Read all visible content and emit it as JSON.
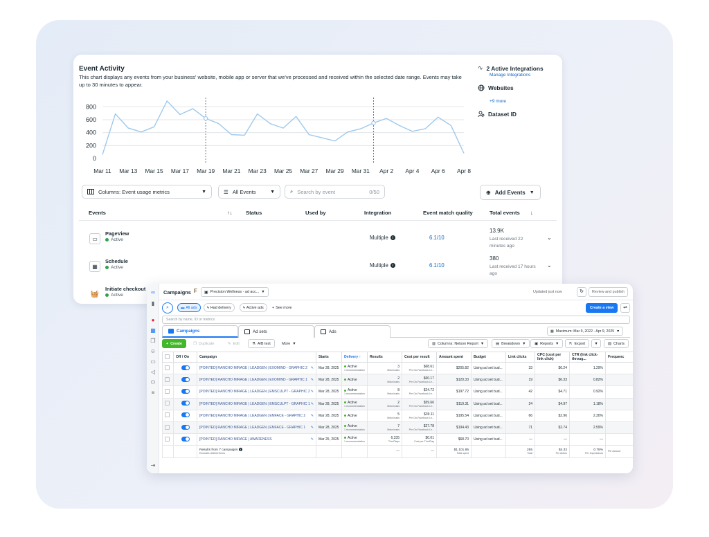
{
  "colors": {
    "accent": "#1877f2",
    "link": "#0a66c2",
    "active_green": "#31a24c",
    "chart_line": "#9ec9ec"
  },
  "event_activity": {
    "title": "Event Activity",
    "description": "This chart displays any events from your business' website, mobile app or server that we've processed and received within the selected date range. Events may take up to 30 minutes to appear."
  },
  "chart_data": {
    "type": "line",
    "title": "",
    "xlabel": "",
    "ylabel": "",
    "ylim": [
      0,
      900
    ],
    "yticks": [
      "800",
      "600",
      "400",
      "200",
      "0"
    ],
    "x_tick_labels": [
      "Mar 11",
      "Mar 13",
      "Mar 15",
      "Mar 17",
      "Mar 19",
      "Mar 21",
      "Mar 23",
      "Mar 25",
      "Mar 27",
      "Mar 29",
      "Mar 31",
      "Apr 2",
      "Apr 4",
      "Apr 6",
      "Apr 8"
    ],
    "x": [
      "Mar 11",
      "Mar 12",
      "Mar 13",
      "Mar 14",
      "Mar 15",
      "Mar 16",
      "Mar 17",
      "Mar 18",
      "Mar 19",
      "Mar 20",
      "Mar 21",
      "Mar 22",
      "Mar 23",
      "Mar 24",
      "Mar 25",
      "Mar 26",
      "Mar 27",
      "Mar 28",
      "Mar 29",
      "Mar 30",
      "Mar 31",
      "Apr 1",
      "Apr 2",
      "Apr 3",
      "Apr 4",
      "Apr 5",
      "Apr 6",
      "Apr 7",
      "Apr 8"
    ],
    "series": [
      {
        "values": [
          60,
          690,
          470,
          410,
          490,
          890,
          680,
          770,
          620,
          540,
          370,
          360,
          690,
          540,
          470,
          650,
          370,
          320,
          270,
          410,
          460,
          550,
          620,
          510,
          420,
          460,
          640,
          510,
          80
        ]
      }
    ],
    "markers_at": [
      "Mar 19",
      "Apr 1"
    ],
    "grid": true
  },
  "right_panel": {
    "integrations": "2 Active Integrations",
    "manage": "Manage Integrations",
    "websites": "Websites",
    "more": "+9 more",
    "dataset": "Dataset ID"
  },
  "toolbar": {
    "columns": "Columns: Event usage metrics",
    "all_events": "All Events",
    "search_placeholder": "Search by event",
    "search_count": "0/50",
    "add_events": "Add Events"
  },
  "events_table": {
    "headers": {
      "events": "Events",
      "sort": "↑↓",
      "status": "Status",
      "used_by": "Used by",
      "integration": "Integration",
      "emq": "Event match quality",
      "total": "Total events",
      "total_sort": "↓"
    },
    "rows": [
      {
        "name": "PageView",
        "status": "Active",
        "integration": "Multiple",
        "emq": "6.1/10",
        "total": "13.9K",
        "received": "Last received 22 minutes ago",
        "icon": "page-icon"
      },
      {
        "name": "Schedule",
        "status": "Active",
        "integration": "Multiple",
        "emq": "6.1/10",
        "total": "380",
        "received": "Last received 17 hours ago",
        "icon": "calendar-icon"
      },
      {
        "name": "Initiate checkout",
        "status": "Active",
        "icon": "basket-icon"
      }
    ]
  },
  "ads_manager": {
    "title": "Campaigns",
    "account": "Precision Wellness - ad acc...",
    "updated": "Updated just now",
    "review": "Review and publish",
    "more": "···",
    "filters": [
      "All ads",
      "Had delivery",
      "Active ads",
      "See more"
    ],
    "create_view": "Create a view",
    "search_placeholder": "Search by name, ID or metrics",
    "tabs": [
      "Campaigns",
      "Ad sets",
      "Ads"
    ],
    "date_range": "Maximum: Mar 9, 2022 - Apr 9, 2025",
    "actions": {
      "create": "Create",
      "duplicate": "Duplicate",
      "edit": "Edit",
      "ab_test": "A/B test",
      "more": "More",
      "columns": "Columns: Nelson Report",
      "breakdown": "Breakdown",
      "reports": "Reports",
      "export": "Export",
      "charts": "Charts"
    },
    "columns": [
      "Off / On",
      "Campaign",
      "Starts",
      "Delivery ↑",
      "Results",
      "Cost per result",
      "Amount spent",
      "Budget",
      "Link clicks",
      "CPC (cost per link click)",
      "CTR (link click-throug...",
      "Frequenc"
    ],
    "rows": [
      {
        "name": "[POINTED] RANCHO MIRAGE | LEADGEN | EXOMIND - GRAPHIC 2",
        "starts": "Mar 28, 2025",
        "delivery": "Active",
        "delivery_sub": "1 recommendation",
        "results": "3",
        "results_sub": "Meta leads",
        "cost": "$68.61",
        "cost_sub": "Per On-Facebook Le...",
        "spent": "$205.82",
        "budget": "Using ad set bud...",
        "clicks": "33",
        "cpc": "$6.24",
        "ctr": "1.29%"
      },
      {
        "name": "[POINTED] RANCHO MIRAGE | LEADGEN | EXOMIND - GRAPHIC 1",
        "starts": "Mar 28, 2025",
        "delivery": "Active",
        "delivery_sub": "",
        "results": "2",
        "results_sub": "Meta leads",
        "cost": "$60.17",
        "cost_sub": "Per On-Facebook Le...",
        "spent": "$120.33",
        "budget": "Using ad set bud...",
        "clicks": "19",
        "cpc": "$6.33",
        "ctr": "0.82%"
      },
      {
        "name": "[POINTED] RANCHO MIRAGE | LEADGEN | EMSCULPT - GRAPHIC 2",
        "starts": "Mar 28, 2025",
        "delivery": "Active",
        "delivery_sub": "1 recommendation",
        "results": "8",
        "results_sub": "Meta leads",
        "cost": "$24.72",
        "cost_sub": "Per On-Facebook Le...",
        "spent": "$197.72",
        "budget": "Using ad set bud...",
        "clicks": "42",
        "cpc": "$4.71",
        "ctr": "0.92%"
      },
      {
        "name": "[POINTED] RANCHO MIRAGE | LEADGEN | EMSCULPT - GRAPHIC 1",
        "starts": "Mar 28, 2025",
        "delivery": "Active",
        "delivery_sub": "1 recommendation",
        "results": "2",
        "results_sub": "Meta leads",
        "cost": "$59.66",
        "cost_sub": "Per On-Facebook Le...",
        "spent": "$119.31",
        "budget": "Using ad set bud...",
        "clicks": "24",
        "cpc": "$4.97",
        "ctr": "1.18%"
      },
      {
        "name": "[POINTED] RANCHO MIRAGE | LEADGEN | EMFACE - GRAPHIC 2",
        "starts": "Mar 28, 2025",
        "delivery": "Active",
        "delivery_sub": "",
        "results": "5",
        "results_sub": "Meta leads",
        "cost": "$39.11",
        "cost_sub": "Per On-Facebook Le...",
        "spent": "$195.54",
        "budget": "Using ad set bud...",
        "clicks": "66",
        "cpc": "$2.96",
        "ctr": "2.30%"
      },
      {
        "name": "[POINTED] RANCHO MIRAGE | LEADGEN | EMFACE - GRAPHIC 1",
        "starts": "Mar 28, 2025",
        "delivery": "Active",
        "delivery_sub": "1 recommendation",
        "results": "7",
        "results_sub": "Meta leads",
        "cost": "$27.78",
        "cost_sub": "Per On-Facebook Le...",
        "spent": "$194.43",
        "budget": "Using ad set bud...",
        "clicks": "71",
        "cpc": "$2.74",
        "ctr": "2.59%"
      },
      {
        "name": "[POINTED] RANCHO MIRAGE | AWARENESS",
        "starts": "Mar 25, 2025",
        "delivery": "Active",
        "delivery_sub": "1 recommendation",
        "results": "6,335",
        "results_sub": "ThruPlays",
        "cost": "$0.01",
        "cost_sub": "Cost per ThruPlay",
        "spent": "$68.70",
        "budget": "Using ad set bud...",
        "clicks": "—",
        "cpc": "—",
        "ctr": "—"
      }
    ],
    "totals": {
      "label": "Results from 7 campaigns",
      "sub": "Excludes deleted items",
      "results": "—",
      "cost": "—",
      "spent": "$1,101.85",
      "spent_sub": "Total spent",
      "clicks": "255",
      "clicks_sub": "Total",
      "cpc": "$4.32",
      "cpc_sub": "Per Action",
      "ctr": "0.78%",
      "ctr_sub": "Per Impressions",
      "freq_sub": "Per Accoun"
    }
  }
}
